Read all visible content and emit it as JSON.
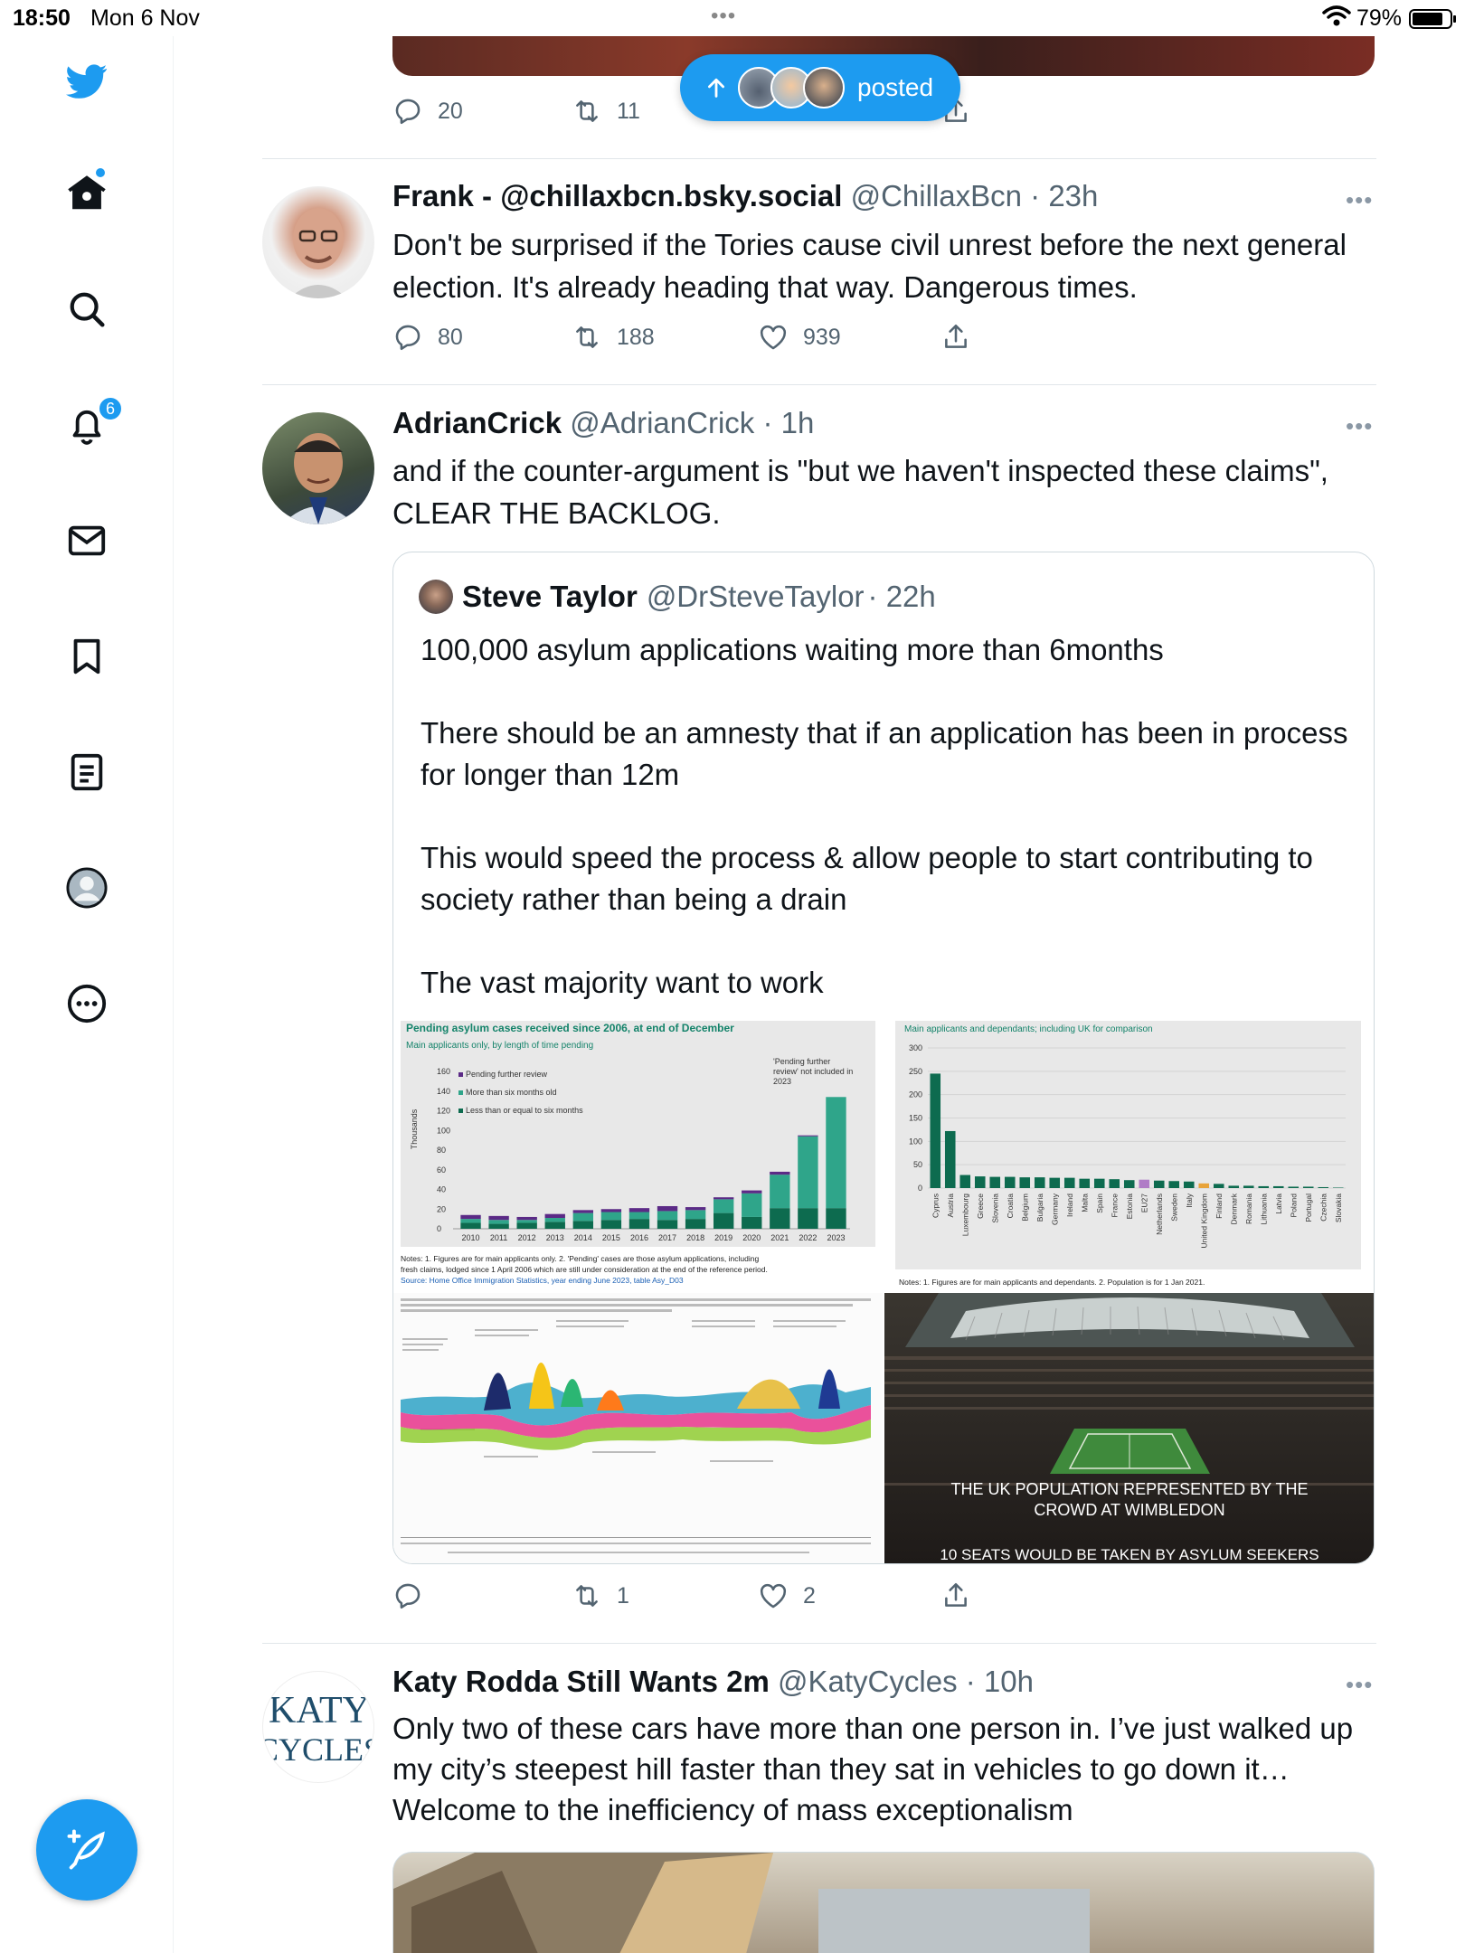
{
  "status_bar": {
    "time": "18:50",
    "date": "Mon 6 Nov",
    "battery": "79%"
  },
  "nav": {
    "notifications_badge": "6"
  },
  "pill": {
    "label": "posted"
  },
  "prev_tweet": {
    "reply_count": "20",
    "retweet_count": "11"
  },
  "tweets": [
    {
      "name": "Frank - @chillaxbcn.bsky.social",
      "handle": "@ChillaxBcn",
      "time": "· 23h",
      "text": "Don't be surprised if the Tories cause civil unrest before the next general election. It's already heading that way. Dangerous times.",
      "replies": "80",
      "retweets": "188",
      "likes": "939"
    },
    {
      "name": "AdrianCrick",
      "handle": "@AdrianCrick",
      "time": "· 1h",
      "text": "and if the counter-argument is \"but we haven't inspected these claims\", CLEAR THE BACKLOG.",
      "replies": "",
      "retweets": "1",
      "likes": "2",
      "quote": {
        "name": "Steve Taylor",
        "handle": "@DrSteveTaylor",
        "time": "· 22h",
        "paragraphs": [
          "100,000 asylum applications waiting more than 6months",
          "There should be an amnesty that if an application has been in process for longer than 12m",
          "This would speed the process & allow people to start contributing to society rather than being a drain",
          "The vast majority want to work"
        ]
      }
    },
    {
      "name": "Katy Rodda Still Wants 2m",
      "handle": "@KatyCycles",
      "time": "· 10h",
      "text": "Only two of these cars have more than one person in. I’ve just walked up my city’s steepest hill faster than they sat in vehicles to go down it… Welcome to the inefficiency of mass exceptionalism",
      "logo_top": "KATY",
      "logo_bottom": "CYCLES"
    }
  ],
  "media": {
    "chart1": {
      "title": "Pending asylum cases received since 2006, at end of December",
      "subtitle": "Main applicants only, by length of time pending",
      "ylabel": "Thousands",
      "note": "'Pending further review' not included in 2023",
      "legend": [
        "Pending further review",
        "More than six months old",
        "Less than or equal to six months"
      ],
      "years": [
        "2010",
        "2011",
        "2012",
        "2013",
        "2014",
        "2015",
        "2016",
        "2017",
        "2018",
        "2019",
        "2020",
        "2021",
        "2022",
        "2023"
      ],
      "yticks": [
        "160",
        "140",
        "120",
        "100",
        "80",
        "60",
        "40",
        "20",
        "0"
      ],
      "footnote1": "Notes: 1. Figures are for main applicants only. 2. 'Pending' cases are those asylum applications, including",
      "footnote2": "fresh claims, lodged since 1 April 2006 which are still under consideration at the end of the reference period.",
      "footnote3": "Source: Home Office Immigration Statistics, year ending June 2023, table Asy_D03"
    },
    "chart2": {
      "subtitle": "Main applicants and dependants; including UK for comparison",
      "yticks": [
        "300",
        "250",
        "200",
        "150",
        "100",
        "50",
        "0"
      ],
      "countries": [
        "Cyprus",
        "Austria",
        "Luxembourg",
        "Greece",
        "Slovenia",
        "Croatia",
        "Belgium",
        "Bulgaria",
        "Germany",
        "Ireland",
        "Malta",
        "Spain",
        "France",
        "Estonia",
        "EU27",
        "Netherlands",
        "Sweden",
        "Italy",
        "United Kingdom",
        "Finland",
        "Denmark",
        "Romania",
        "Lithuania",
        "Latvia",
        "Poland",
        "Portugal",
        "Czechia",
        "Slovakia"
      ],
      "footnote": "Notes: 1. Figures are for main applicants and dependants. 2. Population is for 1 Jan 2021."
    },
    "wimbledon": {
      "line1": "THE UK POPULATION REPRESENTED BY THE",
      "line2": "CROWD AT WIMBLEDON",
      "line3": "10 SEATS WOULD BE TAKEN BY ASYLUM SEEKERS"
    }
  },
  "colors": {
    "accent": "#1d9bf0",
    "dark_green": "#0d6b4f",
    "teal": "#2fa58a",
    "purple": "#5b2a86"
  },
  "chart_data": [
    {
      "type": "bar",
      "title": "Pending asylum cases received since 2006, at end of December",
      "subtitle": "Main applicants only, by length of time pending",
      "ylabel": "Thousands",
      "categories": [
        "2010",
        "2011",
        "2012",
        "2013",
        "2014",
        "2015",
        "2016",
        "2017",
        "2018",
        "2019",
        "2020",
        "2021",
        "2022",
        "2023"
      ],
      "series": [
        {
          "name": "Less than or equal to six months",
          "values": [
            6,
            5,
            6,
            7,
            8,
            9,
            10,
            9,
            10,
            16,
            12,
            21,
            21,
            21
          ]
        },
        {
          "name": "More than six months old",
          "values": [
            4,
            4,
            3,
            4,
            8,
            8,
            7,
            9,
            9,
            14,
            24,
            34,
            73,
            113
          ]
        },
        {
          "name": "Pending further review",
          "values": [
            4,
            4,
            3,
            4,
            3,
            3,
            4,
            5,
            3,
            2,
            3,
            3,
            1,
            0
          ]
        }
      ],
      "ylim": [
        0,
        160
      ]
    },
    {
      "type": "bar",
      "subtitle": "Main applicants and dependants; including UK for comparison",
      "categories": [
        "Cyprus",
        "Austria",
        "Luxembourg",
        "Greece",
        "Slovenia",
        "Croatia",
        "Belgium",
        "Bulgaria",
        "Germany",
        "Ireland",
        "Malta",
        "Spain",
        "France",
        "Estonia",
        "EU27",
        "Netherlands",
        "Sweden",
        "Italy",
        "United Kingdom",
        "Finland",
        "Denmark",
        "Romania",
        "Lithuania",
        "Latvia",
        "Poland",
        "Portugal",
        "Czechia",
        "Slovakia"
      ],
      "values": [
        245,
        122,
        28,
        25,
        24,
        24,
        23,
        23,
        22,
        22,
        20,
        20,
        19,
        17,
        18,
        16,
        15,
        14,
        10,
        9,
        5,
        5,
        4,
        4,
        3,
        3,
        2,
        1
      ],
      "ylim": [
        0,
        300
      ]
    }
  ]
}
